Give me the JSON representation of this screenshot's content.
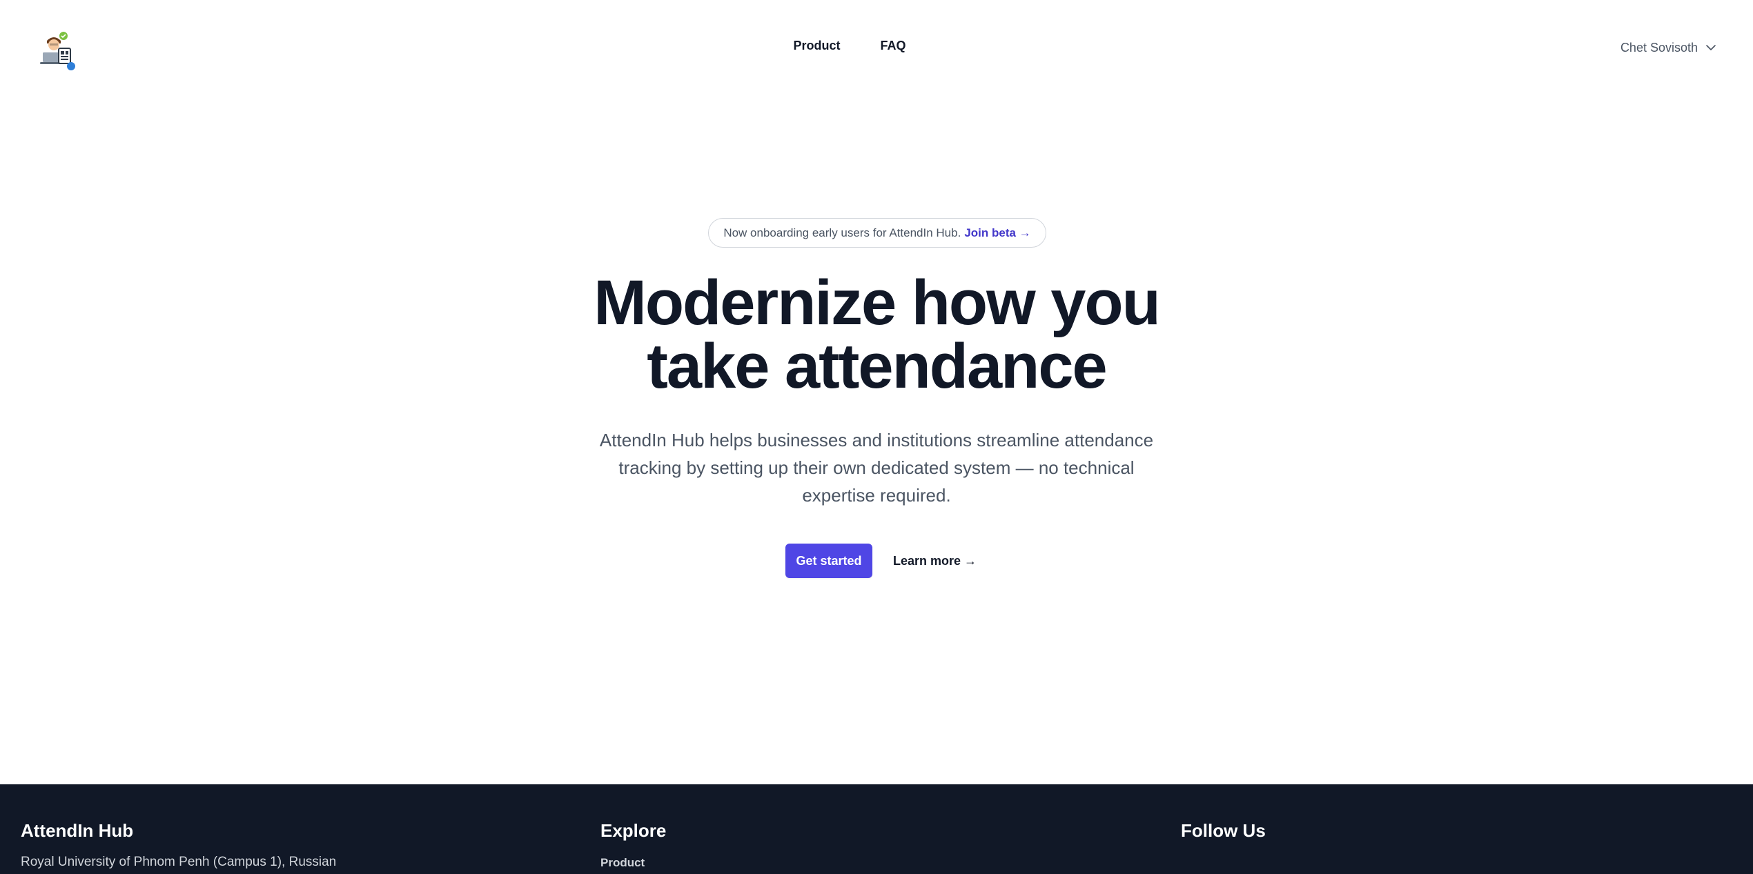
{
  "header": {
    "logo_name": "attendin-hub-logo",
    "nav": [
      {
        "label": "Product"
      },
      {
        "label": "FAQ"
      }
    ],
    "user": {
      "name": "Chet Sovisoth",
      "icon": "chevron-down-icon"
    }
  },
  "hero": {
    "announcement": {
      "text": "Now onboarding early users for AttendIn Hub.",
      "link_label": "Join beta →"
    },
    "headline_line1": "Modernize how you",
    "headline_line2": "take attendance",
    "description": "AttendIn Hub helps businesses and institutions streamline attendance tracking by setting up their own dedicated system — no technical expertise required.",
    "primary_cta": "Get started",
    "secondary_cta": "Learn more →"
  },
  "footer": {
    "brand": {
      "title": "AttendIn Hub",
      "address": "Royal University of Phnom Penh (Campus 1), Russian"
    },
    "explore": {
      "title": "Explore",
      "links": [
        {
          "label": "Product"
        }
      ]
    },
    "follow": {
      "title": "Follow Us"
    }
  },
  "colors": {
    "accent": "#4f46e5",
    "accent_text": "#4338ca",
    "heading": "#111827",
    "body_text": "#4b5563",
    "footer_bg": "#111827"
  }
}
